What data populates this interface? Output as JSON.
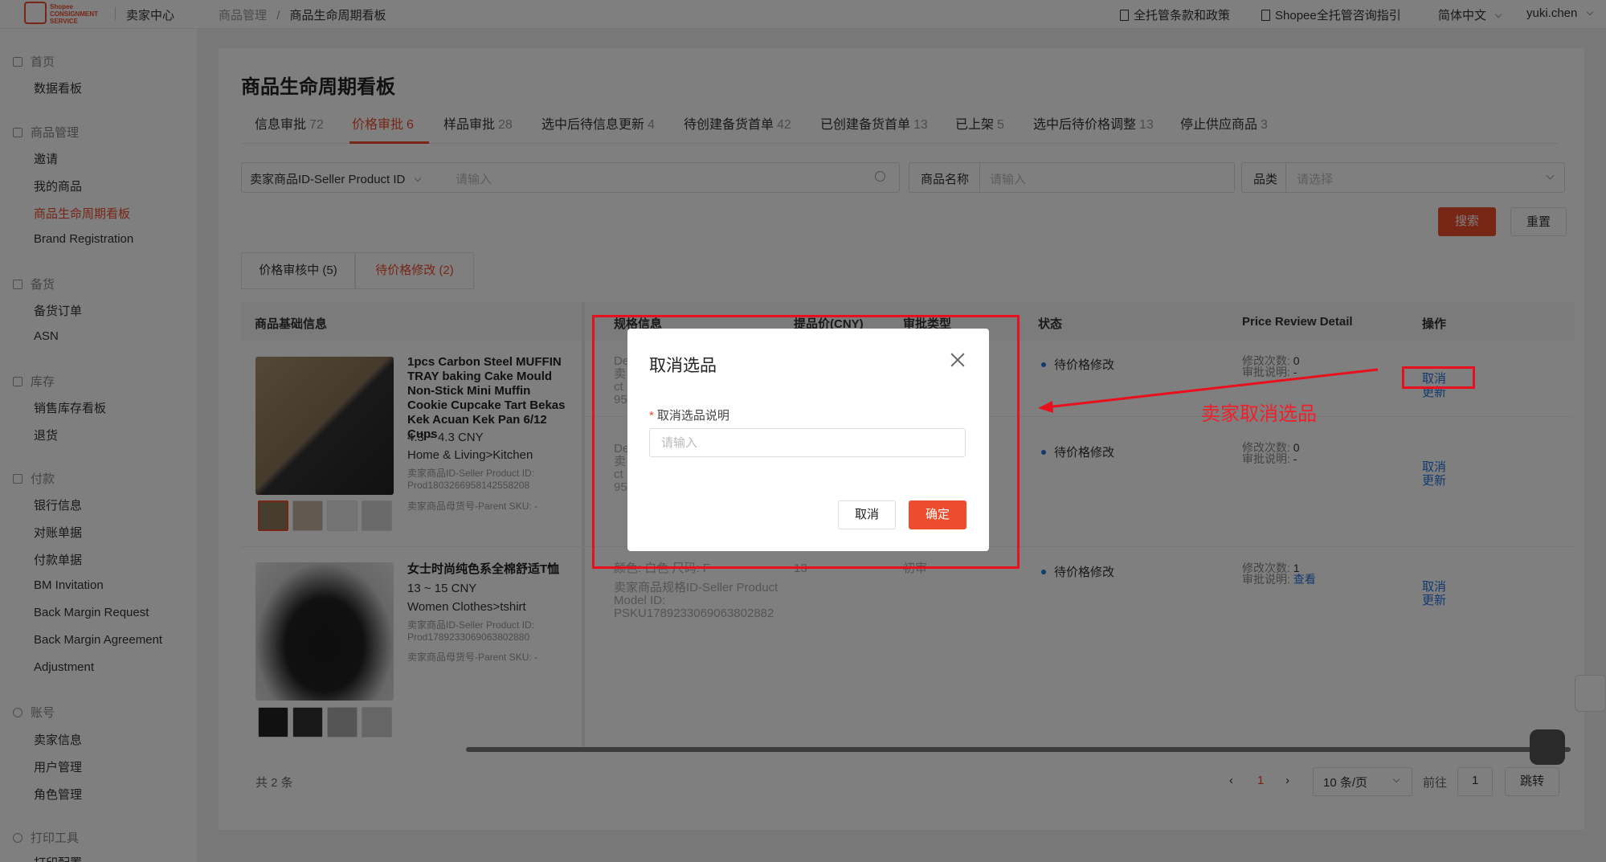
{
  "header": {
    "logo_text": "Shopee CONSIGNMENT SERVICE",
    "app_name": "卖家中心",
    "breadcrumb": [
      "商品管理",
      "商品生命周期看板"
    ],
    "breadcrumb_sep": "/",
    "links": [
      "全托管条款和政策",
      "Shopee全托管咨询指引"
    ],
    "language": "简体中文",
    "user": "yuki.chen"
  },
  "sidebar": {
    "groups": [
      {
        "title": "首页",
        "items": [
          "数据看板"
        ]
      },
      {
        "title": "商品管理",
        "items": [
          "邀请",
          "我的商品",
          "商品生命周期看板",
          "Brand Registration"
        ]
      },
      {
        "title": "备货",
        "items": [
          "备货订单",
          "ASN"
        ]
      },
      {
        "title": "库存",
        "items": [
          "销售库存看板",
          "退货"
        ]
      },
      {
        "title": "付款",
        "items": [
          "银行信息",
          "对账单据",
          "付款单据",
          "BM Invitation",
          "Back Margin Request",
          "Back Margin Agreement",
          "Adjustment"
        ]
      },
      {
        "title": "账号",
        "items": [
          "卖家信息",
          "用户管理",
          "角色管理"
        ]
      },
      {
        "title": "打印工具",
        "items": [
          "打印配置"
        ]
      }
    ],
    "active_item": "商品生命周期看板"
  },
  "page": {
    "title": "商品生命周期看板",
    "tabs": [
      {
        "label": "信息审批",
        "count": "72"
      },
      {
        "label": "价格审批",
        "count": "6"
      },
      {
        "label": "样品审批",
        "count": "28"
      },
      {
        "label": "选中后待信息更新",
        "count": "4"
      },
      {
        "label": "待创建备货首单",
        "count": "42"
      },
      {
        "label": "已创建备货首单",
        "count": "13"
      },
      {
        "label": "已上架",
        "count": "5"
      },
      {
        "label": "选中后待价格调整",
        "count": "13"
      },
      {
        "label": "停止供应商品",
        "count": "3"
      }
    ],
    "active_tab": "价格审批"
  },
  "filters": {
    "id_select": "卖家商品ID-Seller Product ID",
    "id_placeholder": "请输入",
    "name_label": "商品名称",
    "name_placeholder": "请输入",
    "category_label": "品类",
    "category_placeholder": "请选择",
    "search_button": "搜索",
    "reset_button": "重置"
  },
  "subtabs": [
    "价格审核中 (5)",
    "待价格修改 (2)"
  ],
  "table": {
    "columns": [
      "商品基础信息",
      "规格信息",
      "提品价(CNY)",
      "审批类型",
      "状态",
      "Price Review Detail",
      "操作"
    ],
    "rows": [
      {
        "name": "1pcs Carbon Steel MUFFIN TRAY baking Cake Mould Non-Stick Mini Muffin Cookie Cupcake Tart Bekas Kek Acuan Kek Pan 6/12 Cups",
        "price": "4.3 ~ 4.3 CNY",
        "category": "Home & Living>Kitchen",
        "seller_id": "卖家商品ID-Seller Product ID: Prod1803266958142558208",
        "parent_sku": "卖家商品母货号-Parent SKU: -",
        "spec_lines": [
          {
            "l1": "De",
            "l2": "卖",
            "l3": "ct",
            "l4": "95"
          },
          {
            "l1": "De",
            "l2": "卖",
            "l3": "ct",
            "l4": "95"
          }
        ],
        "sub": [
          {
            "status": "待价格修改",
            "edit_label": "修改次数:",
            "edit_count": "0",
            "note_label": "审批说明:",
            "note": "-",
            "op1": "取消",
            "op2": "更新"
          },
          {
            "status": "待价格修改",
            "edit_label": "修改次数:",
            "edit_count": "0",
            "note_label": "审批说明:",
            "note": "-",
            "op1": "取消",
            "op2": "更新"
          }
        ]
      },
      {
        "name": "女士时尚纯色系全棉舒适T恤",
        "price": "13 ~ 15 CNY",
        "category": "Women Clothes>tshirt",
        "seller_id": "卖家商品ID-Seller Product ID: Prod1789233069063802880",
        "parent_sku": "卖家商品母货号-Parent SKU: -",
        "spec_inline": "颜色: 白色    尺码: F",
        "spec_price": "13",
        "spec_type": "初审",
        "spec_model": "卖家商品规格ID-Seller Product Model ID: PSKU1789233069063802882",
        "sub": [
          {
            "status": "待价格修改",
            "edit_label": "修改次数:",
            "edit_count": "1",
            "note_label": "审批说明:",
            "note": "查看",
            "op1": "取消",
            "op2": "更新"
          }
        ]
      }
    ]
  },
  "pagination": {
    "total": "共 2 条",
    "current_page": "1",
    "page_size": "10 条/页",
    "goto_label": "前往",
    "goto_value": "1",
    "jump_button": "跳转"
  },
  "dialog": {
    "title": "取消选品",
    "field_label": "取消选品说明",
    "required_mark": "*",
    "placeholder": "请输入",
    "cancel_button": "取消",
    "confirm_button": "确定"
  },
  "annotation": {
    "text": "卖家取消选品",
    "color": "#e8101c"
  },
  "colors": {
    "brand": "#ee4d2d",
    "link": "#2673dd"
  }
}
